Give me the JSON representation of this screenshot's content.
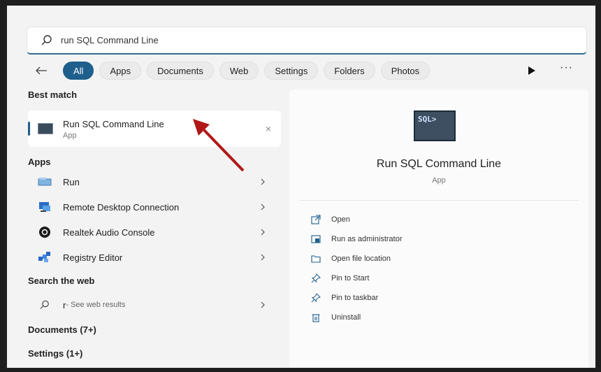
{
  "search": {
    "value": "run SQL Command Line",
    "placeholder": ""
  },
  "filters": {
    "tabs": [
      "All",
      "Apps",
      "Documents",
      "Web",
      "Settings",
      "Folders",
      "Photos"
    ],
    "more": "···"
  },
  "left": {
    "best_match_heading": "Best match",
    "best_match": {
      "title": "Run SQL Command Line",
      "subtitle": "App"
    },
    "apps_heading": "Apps",
    "apps": [
      {
        "label": "Run",
        "icon": "run-icon"
      },
      {
        "label": "Remote Desktop Connection",
        "icon": "remote-desktop-icon"
      },
      {
        "label": "Realtek Audio Console",
        "icon": "realtek-audio-icon"
      },
      {
        "label": "Registry Editor",
        "icon": "registry-editor-icon"
      }
    ],
    "web_heading": "Search the web",
    "web_result": {
      "query": "r",
      "suffix": " - See web results"
    },
    "documents_heading": "Documents (7+)",
    "settings_heading": "Settings (1+)"
  },
  "right": {
    "icon_text": "SQL>",
    "title": "Run SQL Command Line",
    "subtitle": "App",
    "actions": [
      "Open",
      "Run as administrator",
      "Open file location",
      "Pin to Start",
      "Pin to taskbar",
      "Uninstall"
    ]
  },
  "colors": {
    "accent": "#1f5f8c",
    "annotation_arrow": "#b01818"
  }
}
